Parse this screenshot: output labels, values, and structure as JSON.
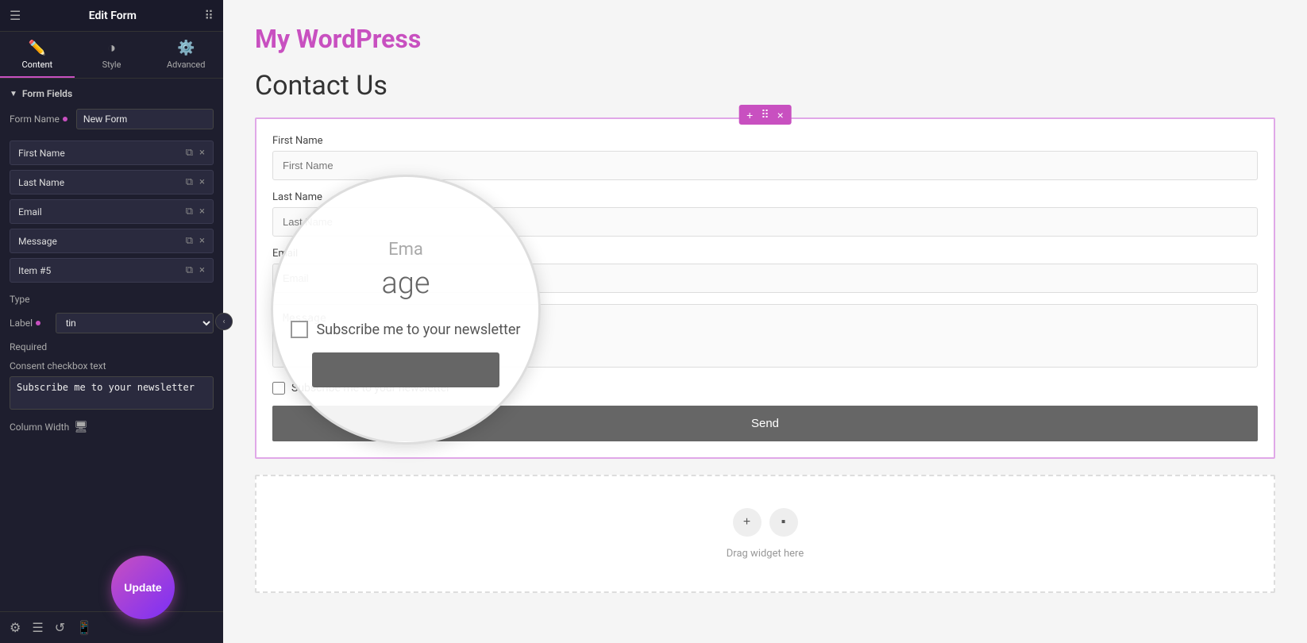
{
  "panel": {
    "header_title": "Edit Form",
    "tabs": [
      {
        "label": "Content",
        "icon": "✏️",
        "active": true
      },
      {
        "label": "Style",
        "icon": "◑",
        "active": false
      },
      {
        "label": "Advanced",
        "icon": "⚙️",
        "active": false
      }
    ],
    "section_form_fields": "Form Fields",
    "form_name_label": "Form Name",
    "form_name_value": "New Form",
    "fields": [
      {
        "label": "First Name"
      },
      {
        "label": "Last Name"
      },
      {
        "label": "Email"
      },
      {
        "label": "Message"
      },
      {
        "label": "Item #5"
      }
    ],
    "type_label": "Type",
    "label_label": "Label",
    "label_value": "tin",
    "required_label": "Required",
    "consent_label": "Consent checkbox text",
    "consent_value": "Subscribe me to your newsletter",
    "column_width_label": "Column Width",
    "update_btn": "Update"
  },
  "main": {
    "site_title": "My WordPress",
    "page_title": "Contact Us",
    "form": {
      "fields": [
        {
          "label": "First Name",
          "placeholder": "First Name",
          "type": "text"
        },
        {
          "label": "Last Name",
          "placeholder": "Last Name",
          "type": "text"
        },
        {
          "label": "Email",
          "placeholder": "Email",
          "type": "text"
        }
      ],
      "message_placeholder": "Message",
      "checkbox_label": "Subscribe me to your newsletter",
      "send_btn": "Send"
    },
    "drop_zone_text": "Drag widget here",
    "widget_toolbar": {
      "add": "+",
      "move": "⠿",
      "close": "×"
    }
  },
  "magnifier": {
    "text": "age",
    "checkbox_label": "Subscribe me to your newsletter"
  }
}
